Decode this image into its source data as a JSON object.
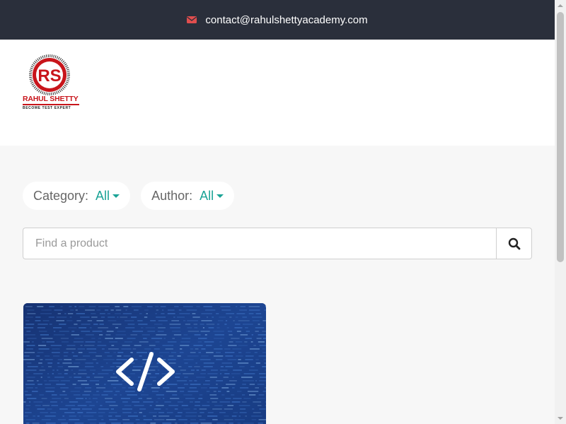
{
  "topbar": {
    "email": "contact@rahulshettyacademy.com",
    "icon": "envelope-icon",
    "icon_color": "#e04e4e",
    "background": "#2a2f3b"
  },
  "logo": {
    "monogram": "RS",
    "name": "RAHUL SHETTY",
    "tagline": "BECOME TEST EXPERT",
    "brand_color": "#c8151b"
  },
  "filters": {
    "category": {
      "label": "Category:",
      "value": "All"
    },
    "author": {
      "label": "Author:",
      "value": "All"
    },
    "accent": "#1aa396"
  },
  "search": {
    "placeholder": "Find a product",
    "button_icon": "search-icon"
  },
  "products": [
    {
      "image_icon": "code-brackets-icon",
      "image_background": "#1b3d85"
    }
  ]
}
